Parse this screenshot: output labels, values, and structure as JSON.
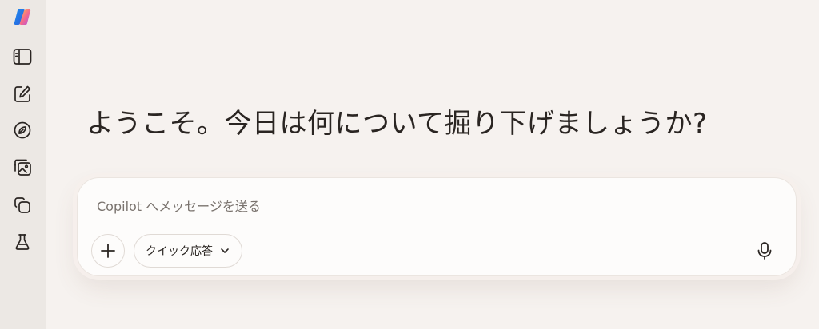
{
  "main": {
    "greeting": "ようこそ。今日は何について掘り下げましょうか?"
  },
  "composer": {
    "placeholder": "Copilot へメッセージを送る",
    "quick_response_label": "クイック応答"
  },
  "sidebar": {
    "icons": [
      "copilot-logo-icon",
      "sidebar-toggle-icon",
      "new-chat-icon",
      "discover-icon",
      "image-gallery-icon",
      "pages-icon",
      "labs-icon"
    ]
  },
  "colors": {
    "background": "#f6f2ef",
    "sidebar": "#ece8e4",
    "composer": "#fdfcfb",
    "text": "#2a2522"
  }
}
